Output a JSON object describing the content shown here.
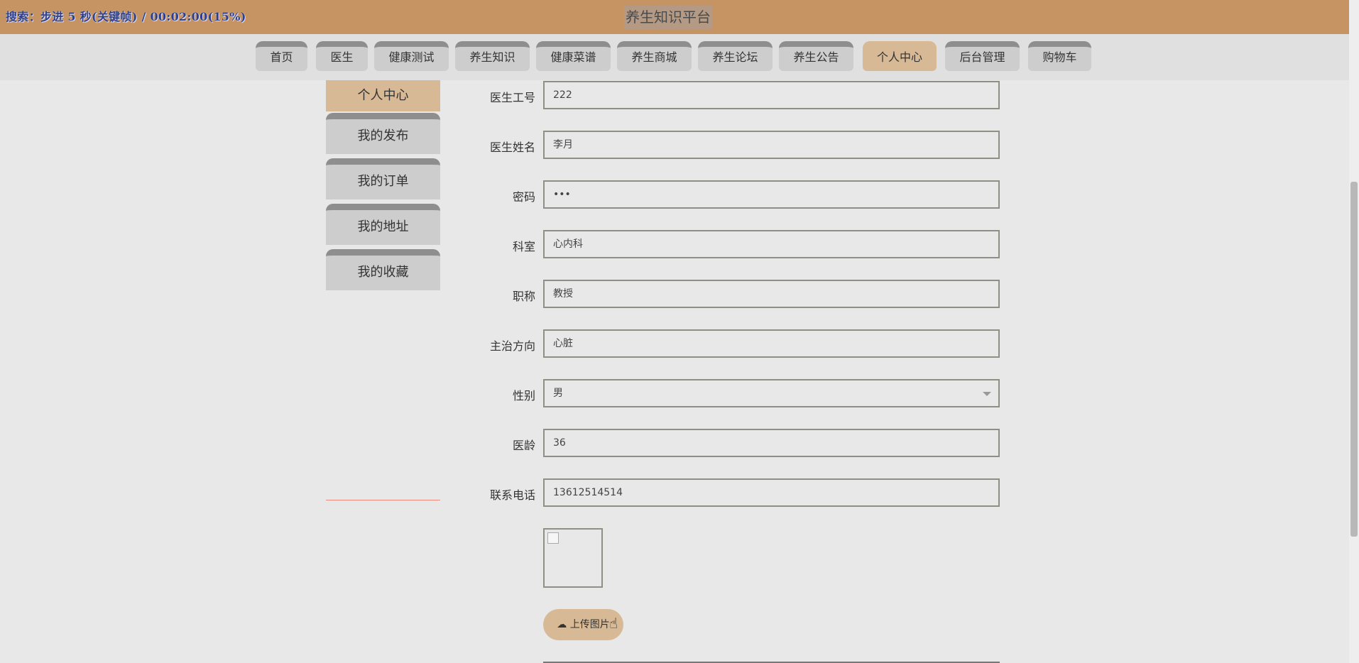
{
  "overlay": {
    "text": "搜索：步进 5 秒(关键帧) / 00:02:00(15%)"
  },
  "header": {
    "title": "养生知识平台"
  },
  "nav": {
    "items": [
      {
        "label": "首页"
      },
      {
        "label": "医生"
      },
      {
        "label": "健康测试"
      },
      {
        "label": "养生知识"
      },
      {
        "label": "健康菜谱"
      },
      {
        "label": "养生商城"
      },
      {
        "label": "养生论坛"
      },
      {
        "label": "养生公告"
      },
      {
        "label": "个人中心",
        "active": true
      },
      {
        "label": "后台管理"
      },
      {
        "label": "购物车"
      }
    ]
  },
  "sidebar": {
    "items": [
      {
        "label": "个人中心",
        "active": true
      },
      {
        "label": "我的发布"
      },
      {
        "label": "我的订单"
      },
      {
        "label": "我的地址"
      },
      {
        "label": "我的收藏"
      }
    ]
  },
  "form": {
    "fields": [
      {
        "label": "医生工号",
        "value": "222"
      },
      {
        "label": "医生姓名",
        "value": "李月"
      },
      {
        "label": "密码",
        "value": "•••"
      },
      {
        "label": "科室",
        "value": "心内科"
      },
      {
        "label": "职称",
        "value": "教授"
      },
      {
        "label": "主治方向",
        "value": "心脏"
      },
      {
        "label": "性别",
        "value": "男",
        "type": "select"
      },
      {
        "label": "医龄",
        "value": "36"
      },
      {
        "label": "联系电话",
        "value": "13612514514"
      }
    ],
    "upload_label": "上传图片",
    "upload_icon": "cloud-upload-icon"
  },
  "colors": {
    "accent": "#c69462",
    "active_tab": "#d7b995",
    "tab_bg": "#cdcdcd"
  }
}
